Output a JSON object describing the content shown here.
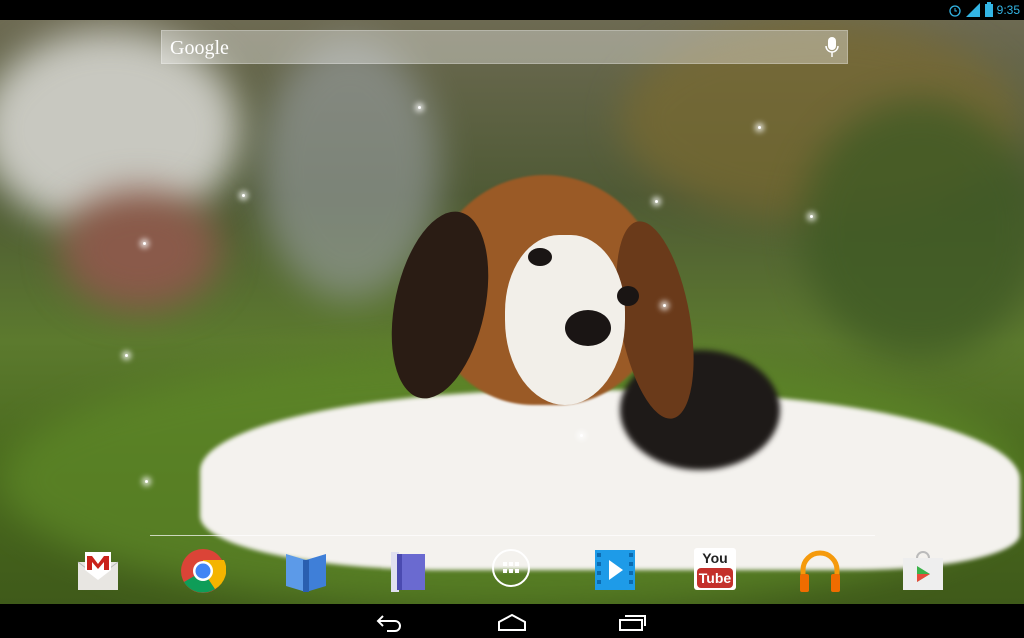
{
  "status_bar": {
    "time": "9:35",
    "icons": [
      "alarm-icon",
      "signal-icon",
      "battery-icon"
    ]
  },
  "search": {
    "logo": "Google",
    "icon": "mic-icon"
  },
  "dock": [
    {
      "app": "Gmail",
      "icon": "gmail-icon"
    },
    {
      "app": "Chrome",
      "icon": "chrome-icon"
    },
    {
      "app": "Play Books",
      "icon": "books-icon"
    },
    {
      "app": "Play Magazines",
      "icon": "magazines-icon"
    },
    {
      "app": "All Apps",
      "icon": "app-drawer-icon"
    },
    {
      "app": "Play Movies",
      "icon": "movies-icon"
    },
    {
      "app": "YouTube",
      "icon": "youtube-icon",
      "logo_text": "You Tube"
    },
    {
      "app": "Play Music",
      "icon": "music-icon"
    },
    {
      "app": "Play Store",
      "icon": "play-store-icon"
    }
  ],
  "nav": {
    "buttons": [
      "back-icon",
      "home-icon",
      "recents-icon"
    ]
  }
}
